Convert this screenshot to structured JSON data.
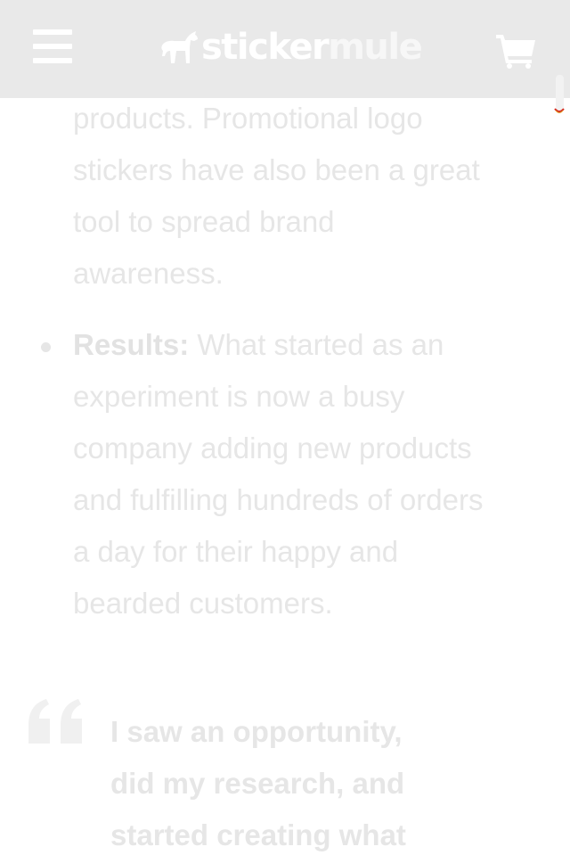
{
  "header": {
    "menu_icon": "hamburger-menu-icon",
    "logo": {
      "part1": "sticker",
      "part2": "mule",
      "mark_icon": "mule-icon"
    },
    "cart_icon": "shopping-cart-icon"
  },
  "article": {
    "partial_paragraph_lines": [
      "products. Promotional logo",
      "stickers have also been a great",
      "tool to spread brand",
      "awareness."
    ],
    "results": {
      "label": "Results:",
      "text_first_line": " What started as an",
      "text_lines": [
        "experiment is now a busy",
        "company adding new products",
        "and fulfilling hundreds of orders",
        "a day for their happy and",
        "bearded customers."
      ]
    },
    "quote": {
      "icon": "quote-icon",
      "lines": [
        "I saw an opportunity,",
        "did my research, and",
        "started creating what"
      ]
    }
  },
  "colors": {
    "header_bg": "#e9e9e9",
    "text": "#e6e6e6",
    "scroll_accent": "#d62d20"
  }
}
